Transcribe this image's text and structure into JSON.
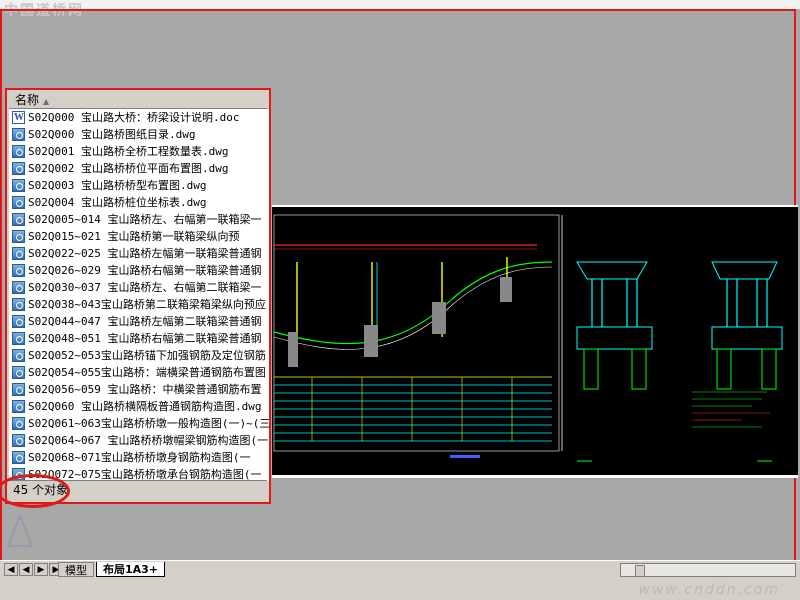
{
  "watermark_top": "中国道桥网",
  "watermark_bottom": "www.cnddn.com",
  "explorer": {
    "column_header": "名称",
    "files": [
      {
        "name": "S02Q000  宝山路大桥：桥梁设计说明.doc",
        "icon": "word-doc-icon"
      },
      {
        "name": "S02Q000  宝山路桥图纸目录.dwg",
        "icon": "dwg-file-icon"
      },
      {
        "name": "S02Q001  宝山路桥全桥工程数量表.dwg",
        "icon": "dwg-file-icon"
      },
      {
        "name": "S02Q002  宝山路桥桥位平面布置图.dwg",
        "icon": "dwg-file-icon"
      },
      {
        "name": "S02Q003  宝山路桥桥型布置图.dwg",
        "icon": "dwg-file-icon"
      },
      {
        "name": "S02Q004  宝山路桥桩位坐标表.dwg",
        "icon": "dwg-file-icon"
      },
      {
        "name": "S02Q005~014  宝山路桥左、右幅第一联箱梁一",
        "icon": "dwg-file-icon"
      },
      {
        "name": "S02Q015~021  宝山路桥第一联箱梁纵向预",
        "icon": "dwg-file-icon"
      },
      {
        "name": "S02Q022~025  宝山路桥左幅第一联箱梁普通钢",
        "icon": "dwg-file-icon"
      },
      {
        "name": "S02Q026~029  宝山路桥右幅第一联箱梁普通钢",
        "icon": "dwg-file-icon"
      },
      {
        "name": "S02Q030~037  宝山路桥左、右幅第二联箱梁一",
        "icon": "dwg-file-icon"
      },
      {
        "name": "S02Q038~043宝山路桥第二联箱梁箱梁纵向预应",
        "icon": "dwg-file-icon"
      },
      {
        "name": "S02Q044~047  宝山路桥左幅第二联箱梁普通钢",
        "icon": "dwg-file-icon"
      },
      {
        "name": "S02Q048~051  宝山路桥右幅第二联箱梁普通钢",
        "icon": "dwg-file-icon"
      },
      {
        "name": "S02Q052~053宝山路桥锚下加强钢筋及定位钢筋",
        "icon": "dwg-file-icon"
      },
      {
        "name": "S02Q054~055宝山路桥：端横梁普通钢筋布置图",
        "icon": "dwg-file-icon"
      },
      {
        "name": "S02Q056~059  宝山路桥：中横梁普通钢筋布置",
        "icon": "dwg-file-icon"
      },
      {
        "name": "S02Q060  宝山路桥横隔板普通钢筋构造图.dwg",
        "icon": "dwg-file-icon"
      },
      {
        "name": "S02Q061~063宝山路桥桥墩一般构造图(一)~(三",
        "icon": "dwg-file-icon"
      },
      {
        "name": "S02Q064~067  宝山路桥桥墩帽梁钢筋构造图(一",
        "icon": "dwg-file-icon"
      },
      {
        "name": "S02Q068~071宝山路桥桥墩身钢筋构造图(一",
        "icon": "dwg-file-icon"
      },
      {
        "name": "S02Q072~075宝山路桥桥墩承台钢筋构造图(一",
        "icon": "dwg-file-icon"
      }
    ],
    "status": "45 个对象"
  },
  "tabs": {
    "model": "模型",
    "layout": "布局1A3+"
  }
}
